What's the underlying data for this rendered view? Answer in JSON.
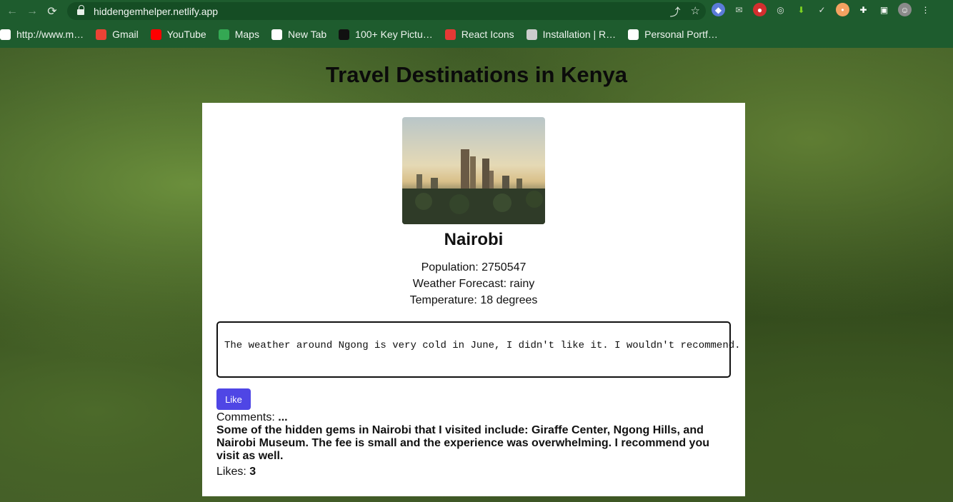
{
  "browser": {
    "url": "hiddengemhelper.netlify.app",
    "bookmarks": [
      {
        "label": "http://www.m…",
        "icon": "bookmark-favicon-icon",
        "color": "#ffffff"
      },
      {
        "label": "Gmail",
        "icon": "gmail-icon",
        "color": "#ea4335"
      },
      {
        "label": "YouTube",
        "icon": "youtube-icon",
        "color": "#ff0000"
      },
      {
        "label": "Maps",
        "icon": "maps-icon",
        "color": "#34a853"
      },
      {
        "label": "New Tab",
        "icon": "globe-icon",
        "color": "#ffffff"
      },
      {
        "label": "100+ Key Pictu…",
        "icon": "bookmark-favicon-icon",
        "color": "#111111"
      },
      {
        "label": "React Icons",
        "icon": "react-icon",
        "color": "#e53935"
      },
      {
        "label": "Installation | R…",
        "icon": "package-icon",
        "color": "#cccccc"
      },
      {
        "label": "Personal Portf…",
        "icon": "globe-icon",
        "color": "#ffffff"
      }
    ]
  },
  "page": {
    "title": "Travel Destinations in Kenya"
  },
  "destination": {
    "name": "Nairobi",
    "population": "Population: 2750547",
    "weather": "Weather Forecast: rainy",
    "temperature": "Temperature: 18 degrees",
    "review_text": "The weather around Ngong is very cold in June, I didn't like it. I wouldn't recommend.",
    "like_label": "Like",
    "comments_label": "Comments:",
    "comments_ellipsis": "...",
    "comment_text": "Some of the hidden gems in Nairobi that I visited include: Giraffe Center, Ngong Hills, and Nairobi Museum. The fee is small and the experience was overwhelming. I recommend you visit as well.",
    "likes_label": "Likes:",
    "likes_count": "3"
  },
  "colors": {
    "like_button": "#4f46e5",
    "chrome": "#1e5c2e"
  }
}
